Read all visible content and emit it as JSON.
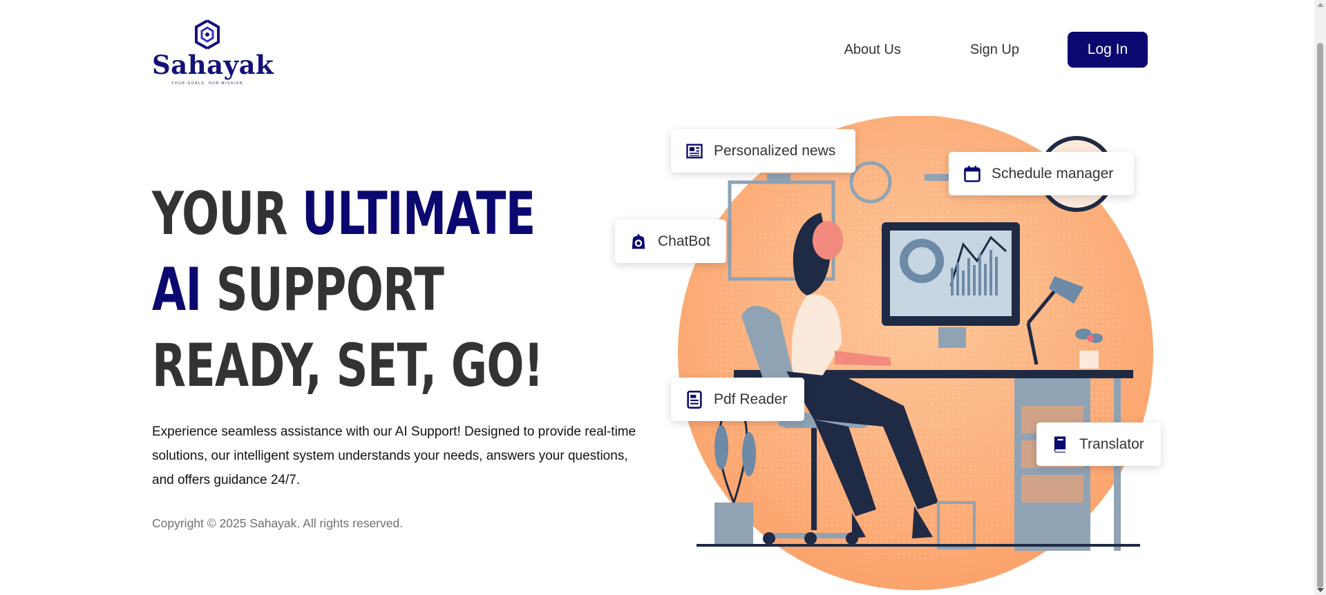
{
  "brand": {
    "name": "Sahayak",
    "tagline": "YOUR GOALS, OUR MISSION",
    "primary_color": "#0b0870"
  },
  "nav": {
    "about_label": "About Us",
    "signup_label": "Sign Up",
    "login_label": "Log In"
  },
  "hero": {
    "line1_a": "YOUR ",
    "line1_b": "ULTIMATE",
    "line2_a": "AI",
    "line2_b": " SUPPORT",
    "line3": "READY, SET, GO!",
    "description": "Experience seamless assistance with our AI Support! Designed to provide real-time solutions, our intelligent system understands your needs, answers your questions, and offers guidance 24/7."
  },
  "footer": {
    "copyright": "Copyright © 2025 Sahayak. All rights reserved."
  },
  "features": [
    {
      "label": "Personalized news",
      "icon": "newspaper-icon"
    },
    {
      "label": "Schedule manager",
      "icon": "calendar-icon"
    },
    {
      "label": "ChatBot",
      "icon": "robot-icon"
    },
    {
      "label": "Pdf Reader",
      "icon": "document-icon"
    },
    {
      "label": "Translator",
      "icon": "book-icon"
    }
  ],
  "illustration": {
    "subject": "woman working at desk with computer",
    "circle_color": "#fdb27f"
  }
}
